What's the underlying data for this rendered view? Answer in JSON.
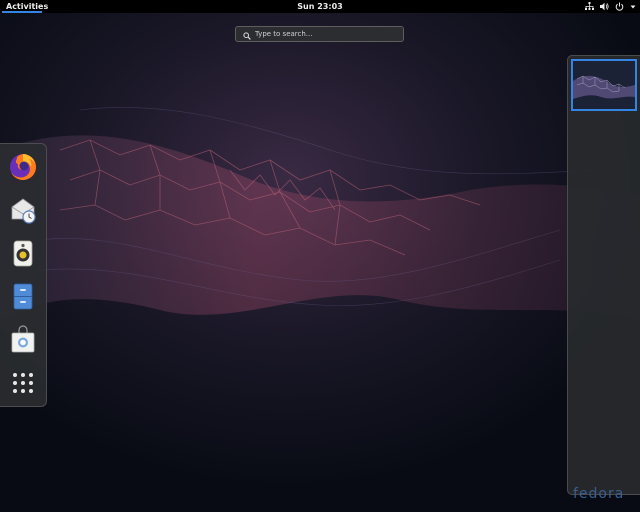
{
  "topbar": {
    "activities_label": "Activities",
    "clock": "Sun 23:03"
  },
  "system_icons": [
    "network-icon",
    "volume-icon",
    "power-icon",
    "chevron-down-icon"
  ],
  "search": {
    "placeholder": "Type to search..."
  },
  "dash": {
    "apps": [
      "firefox",
      "evolution-mail",
      "rhythmbox",
      "files",
      "software"
    ],
    "show_apps": "show-applications"
  },
  "workspaces": {
    "count": 1,
    "active": 1
  },
  "wallpaper_watermark": "fedora",
  "colors": {
    "accent": "#3584e4",
    "topbar": "#000000",
    "panel": "#2a2c30"
  }
}
